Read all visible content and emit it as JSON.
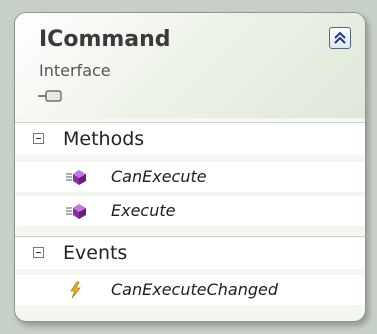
{
  "type_shape": {
    "name": "ICommand",
    "kind": "Interface",
    "collapse_icon": "double-chevron-up-icon",
    "interface_icon": "interface-lollipop-icon"
  },
  "sections": [
    {
      "label": "Methods",
      "expanded": true,
      "members": [
        {
          "name": "CanExecute",
          "icon": "method-icon"
        },
        {
          "name": "Execute",
          "icon": "method-icon"
        }
      ]
    },
    {
      "label": "Events",
      "expanded": true,
      "members": [
        {
          "name": "CanExecuteChanged",
          "icon": "event-lightning-icon"
        }
      ]
    }
  ],
  "colors": {
    "method_icon": "#8b2fa6",
    "event_icon": "#e6a317",
    "header_text": "#3a3a3a"
  }
}
